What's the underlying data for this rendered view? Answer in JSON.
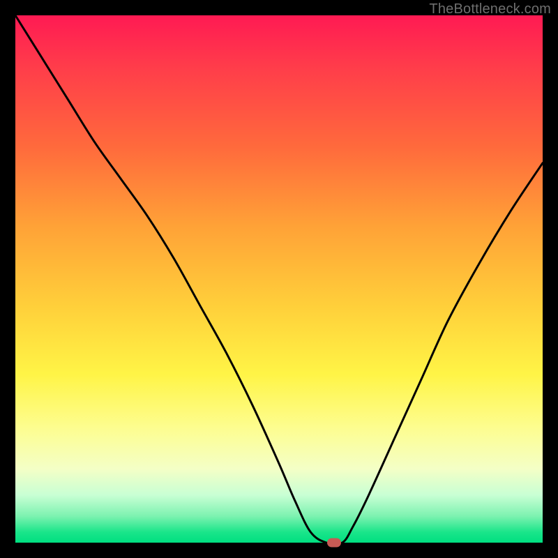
{
  "watermark": "TheBottleneck.com",
  "colors": {
    "frame": "#000000",
    "curve": "#000000",
    "marker": "#c85a54"
  },
  "chart_data": {
    "type": "line",
    "title": "",
    "xlabel": "",
    "ylabel": "",
    "xlim": [
      0,
      100
    ],
    "ylim": [
      0,
      100
    ],
    "grid": false,
    "series": [
      {
        "name": "bottleneck-curve",
        "x": [
          0,
          5,
          10,
          15,
          20,
          25,
          30,
          35,
          40,
          45,
          50,
          53,
          56,
          59,
          62,
          64,
          67,
          72,
          77,
          82,
          88,
          94,
          100
        ],
        "values": [
          100,
          92,
          84,
          76,
          69,
          62,
          54,
          45,
          36,
          26,
          15,
          8,
          2,
          0,
          0,
          3,
          9,
          20,
          31,
          42,
          53,
          63,
          72
        ]
      }
    ],
    "marker": {
      "x": 60.5,
      "y": 0
    },
    "legend": false
  }
}
